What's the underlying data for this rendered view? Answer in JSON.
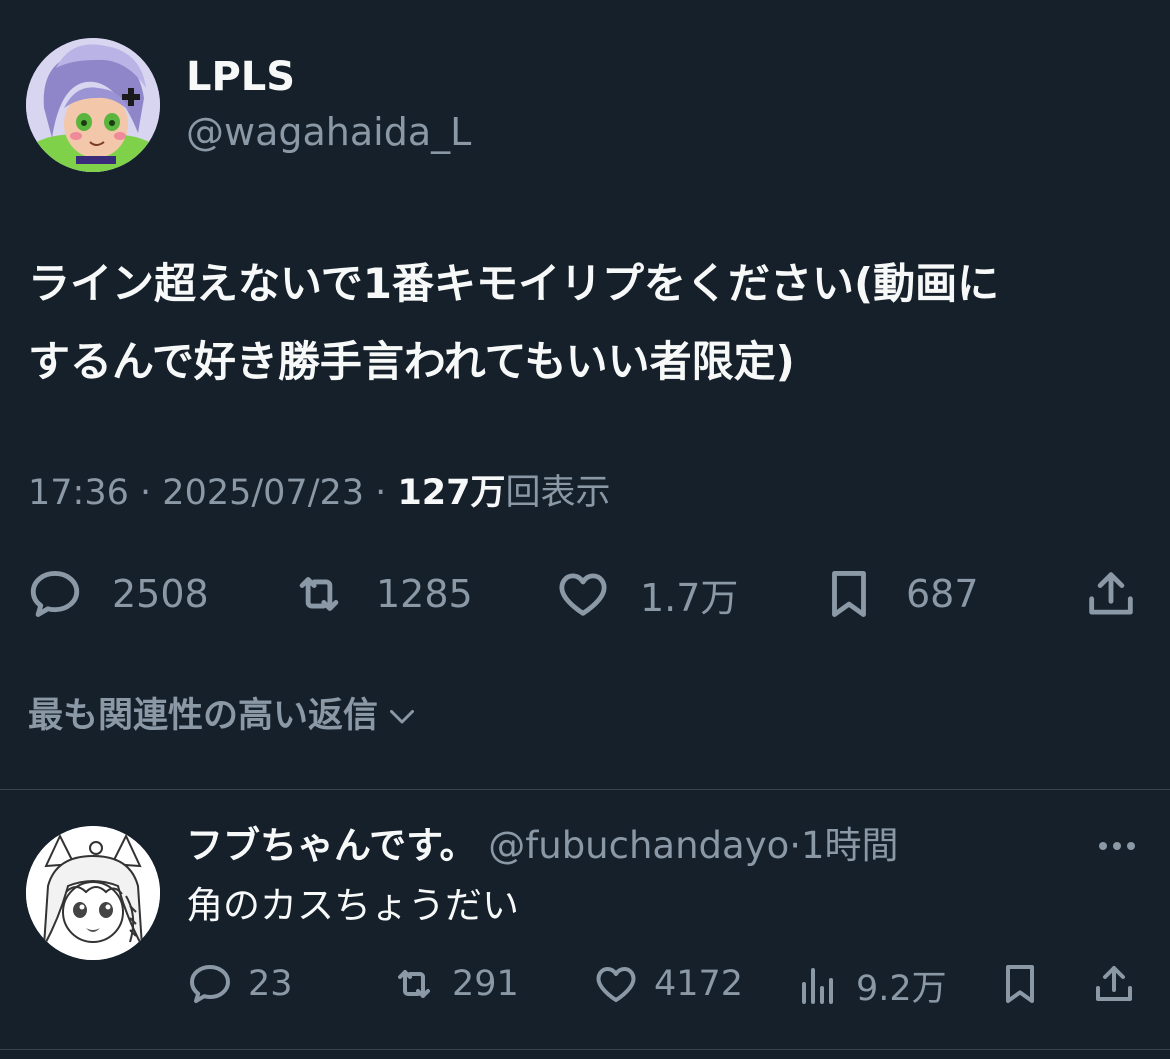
{
  "tweet": {
    "author": {
      "display_name": "LPLS",
      "handle": "@wagahaida_L"
    },
    "text_line1": "ライン超えないで1番キモイリプをください(動画に",
    "text_line2": "するんで好き勝手言われてもいい者限定)",
    "time": "17:36",
    "separator": "·",
    "date": "2025/07/23",
    "views_count": "127万",
    "views_label": "回表示",
    "stats": {
      "replies": "2508",
      "retweets": "1285",
      "likes": "1.7万",
      "bookmarks": "687"
    },
    "icons": [
      "reply-icon",
      "retweet-icon",
      "like-icon",
      "bookmark-icon",
      "share-icon"
    ]
  },
  "sort": {
    "label": "最も関連性の高い返信"
  },
  "reply": {
    "display_name": "フブちゃんです。",
    "handle": "@fubuchandayo",
    "separator": "·",
    "time": "1時間",
    "text": "角のカスちょうだい",
    "stats": {
      "replies": "23",
      "retweets": "291",
      "likes": "4172",
      "views": "9.2万"
    },
    "icons": [
      "reply-icon",
      "retweet-icon",
      "like-icon",
      "views-icon",
      "bookmark-icon",
      "share-icon",
      "more-icon"
    ]
  },
  "colors": {
    "background": "#15202b",
    "primary_text": "#f7f9f9",
    "secondary_text": "#8b98a5",
    "divider": "#38444d"
  }
}
